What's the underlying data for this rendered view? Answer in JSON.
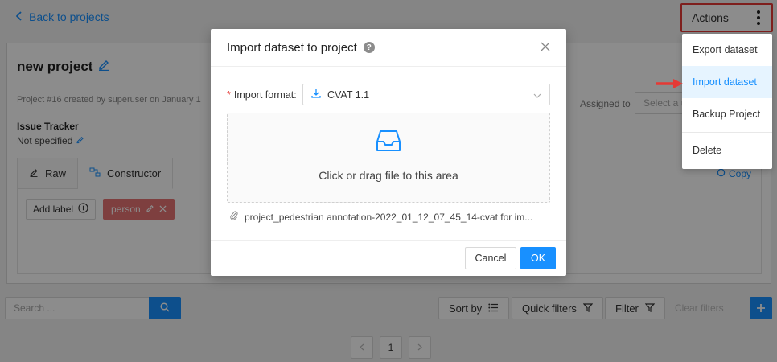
{
  "nav": {
    "back_label": "Back to projects"
  },
  "actions": {
    "label": "Actions",
    "menu": [
      "Export dataset",
      "Import dataset",
      "Backup Project",
      "Delete"
    ]
  },
  "project": {
    "title": "new project",
    "subtitle": "Project #16 created by superuser on January 1",
    "issue_tracker_heading": "Issue Tracker",
    "issue_tracker_value": "Not specified",
    "assigned_label": "Assigned to",
    "assigned_placeholder": "Select a u",
    "tabs": [
      "Raw",
      "Constructor"
    ],
    "copy_label": "Copy",
    "add_label": "Add label",
    "labels": [
      "person"
    ]
  },
  "toolbar": {
    "search_placeholder": "Search ...",
    "sort_label": "Sort by",
    "quick_filters_label": "Quick filters",
    "filter_label": "Filter",
    "clear_filters_label": "Clear filters"
  },
  "pagination": {
    "current": "1"
  },
  "modal": {
    "title": "Import dataset to project",
    "format_label": "Import format:",
    "format_value": "CVAT 1.1",
    "dropzone_text": "Click or drag file to this area",
    "file_name": "project_pedestrian annotation-2022_01_12_07_45_14-cvat for im...",
    "cancel_label": "Cancel",
    "ok_label": "OK"
  },
  "colors": {
    "primary": "#1890ff",
    "highlight": "#e53935",
    "label_tag": "#e57373"
  }
}
